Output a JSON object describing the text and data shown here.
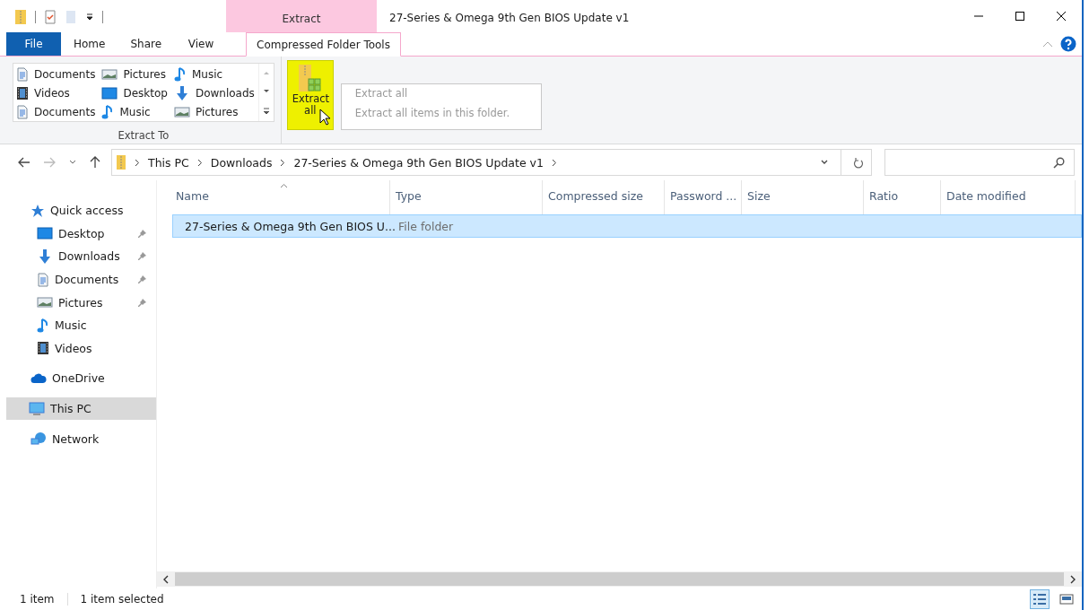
{
  "window": {
    "title": "27-Series & Omega 9th Gen BIOS Update v1"
  },
  "context_tab_group": {
    "label": "Extract"
  },
  "ribbon_tabs": [
    {
      "label": "File",
      "kind": "file",
      "selected": false
    },
    {
      "label": "Home",
      "kind": "tab",
      "selected": false
    },
    {
      "label": "Share",
      "kind": "tab",
      "selected": false
    },
    {
      "label": "View",
      "kind": "tab",
      "selected": false
    },
    {
      "label": "Compressed Folder Tools",
      "kind": "tab",
      "selected": true
    }
  ],
  "extract_to": {
    "label": "Extract To",
    "items": [
      {
        "label": "Documents",
        "kind": "documents"
      },
      {
        "label": "Pictures",
        "kind": "pictures"
      },
      {
        "label": "Music",
        "kind": "music"
      },
      {
        "label": "Videos",
        "kind": "videos"
      },
      {
        "label": "Desktop",
        "kind": "desktop"
      },
      {
        "label": "Downloads",
        "kind": "downloads"
      },
      {
        "label": "Documents",
        "kind": "documents"
      },
      {
        "label": "Music",
        "kind": "music"
      },
      {
        "label": "Pictures",
        "kind": "pictures"
      }
    ]
  },
  "extract_all": {
    "label": "Extract all",
    "highlighted": true
  },
  "tooltip": {
    "title": "Extract all",
    "description": "Extract all items in this folder."
  },
  "address_bar": {
    "path": [
      "This PC",
      "Downloads",
      "27-Series & Omega 9th Gen BIOS Update v1"
    ]
  },
  "navigation": [
    {
      "label": "Quick access",
      "kind": "quick",
      "selected": false,
      "children": [
        {
          "label": "Desktop",
          "kind": "desktop",
          "pinned": true,
          "selected": false
        },
        {
          "label": "Downloads",
          "kind": "downloads",
          "pinned": true,
          "selected": false
        },
        {
          "label": "Documents",
          "kind": "documents",
          "pinned": true,
          "selected": false
        },
        {
          "label": "Pictures",
          "kind": "pictures",
          "pinned": true,
          "selected": false
        },
        {
          "label": "Music",
          "kind": "music",
          "pinned": false,
          "selected": false
        },
        {
          "label": "Videos",
          "kind": "videos",
          "pinned": false,
          "selected": false
        }
      ]
    },
    {
      "label": "OneDrive",
      "kind": "cloud",
      "selected": false
    },
    {
      "label": "This PC",
      "kind": "pc",
      "selected": true
    },
    {
      "label": "Network",
      "kind": "network",
      "selected": false
    }
  ],
  "table": {
    "columns": [
      {
        "label": "Name",
        "sorted": true
      },
      {
        "label": "Type",
        "sorted": false
      },
      {
        "label": "Compressed size",
        "sorted": false
      },
      {
        "label": "Password ...",
        "sorted": false
      },
      {
        "label": "Size",
        "sorted": false
      },
      {
        "label": "Ratio",
        "sorted": false
      },
      {
        "label": "Date modified",
        "sorted": false
      }
    ],
    "rows": [
      {
        "name": "27-Series & Omega 9th Gen BIOS U...",
        "type": "File folder",
        "selected": true
      }
    ]
  },
  "status_bar": {
    "item_count": "1 item",
    "selection": "1 item selected"
  },
  "view_buttons": [
    {
      "kind": "details",
      "selected": true
    },
    {
      "kind": "large-icons",
      "selected": false
    }
  ]
}
